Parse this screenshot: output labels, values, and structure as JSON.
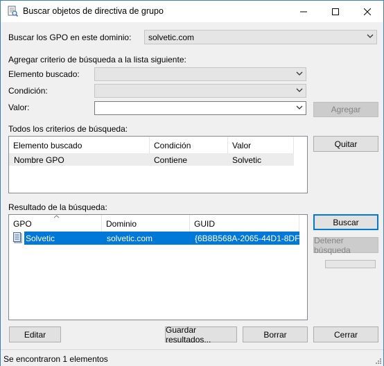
{
  "window": {
    "title": "Buscar objetos de directiva de grupo"
  },
  "domain": {
    "label": "Buscar los GPO en este dominio:",
    "value": "solvetic.com"
  },
  "criteria": {
    "section_label": "Agregar criterio de búsqueda a la lista siguiente:",
    "element_label": "Elemento buscado:",
    "condition_label": "Condición:",
    "value_label": "Valor:",
    "value_input": "",
    "add_button": "Agregar"
  },
  "all_criteria": {
    "section_label": "Todos los criterios de búsqueda:",
    "columns": [
      "Elemento buscado",
      "Condición",
      "Valor"
    ],
    "rows": [
      [
        "Nombre GPO",
        "Contiene",
        "Solvetic"
      ]
    ],
    "remove_button": "Quitar"
  },
  "results": {
    "section_label": "Resultado de la búsqueda:",
    "columns": [
      "GPO",
      "Dominio",
      "GUID"
    ],
    "rows": [
      [
        "Solvetic",
        "solvetic.com",
        "{6B8B568A-2065-44D1-8DF..."
      ]
    ],
    "search_button": "Buscar",
    "stop_button": "Detener búsqueda",
    "progress": 0
  },
  "footer": {
    "edit_button": "Editar",
    "save_button": "Guardar resultados...",
    "clear_button": "Borrar",
    "close_button": "Cerrar"
  },
  "status": {
    "text": "Se encontraron 1 elementos"
  },
  "colors": {
    "selection": "#0078d7",
    "accent_border": "#0078d7"
  }
}
